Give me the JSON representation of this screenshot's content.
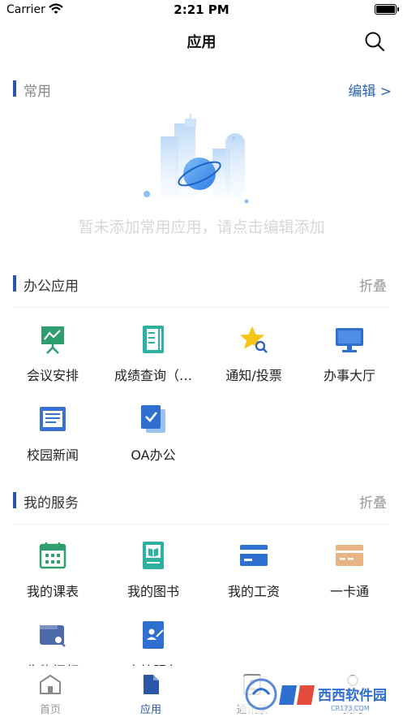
{
  "status_bar": {
    "carrier": "Carrier",
    "time": "2:21 PM"
  },
  "nav": {
    "title": "应用"
  },
  "common": {
    "title": "常用",
    "edit": "编辑 >",
    "empty_text": "暂未添加常用应用，请点击编辑添加"
  },
  "office": {
    "title": "办公应用",
    "collapse": "折叠",
    "items": [
      {
        "label": "会议安排",
        "icon": "meeting-board-icon"
      },
      {
        "label": "成绩查询（…",
        "icon": "grade-report-icon"
      },
      {
        "label": "通知/投票",
        "icon": "star-notice-icon"
      },
      {
        "label": "办事大厅",
        "icon": "monitor-icon"
      },
      {
        "label": "校园新闻",
        "icon": "newspaper-icon"
      },
      {
        "label": "OA办公",
        "icon": "check-document-icon"
      }
    ]
  },
  "services": {
    "title": "我的服务",
    "collapse": "折叠",
    "items": [
      {
        "label": "我的课表",
        "icon": "calendar-icon"
      },
      {
        "label": "我的图书",
        "icon": "book-icon"
      },
      {
        "label": "我的工资",
        "icon": "card-icon"
      },
      {
        "label": "一卡通",
        "icon": "campus-card-icon"
      },
      {
        "label": "失物招领",
        "icon": "wallet-search-icon"
      },
      {
        "label": "离校服务",
        "icon": "leave-school-icon"
      }
    ]
  },
  "tabs": [
    {
      "label": "首页",
      "icon": "home-icon",
      "active": false
    },
    {
      "label": "应用",
      "icon": "apps-icon",
      "active": true
    },
    {
      "label": "通讯录",
      "icon": "contacts-icon",
      "active": false
    },
    {
      "label": "我的",
      "icon": "profile-icon",
      "active": false
    }
  ],
  "watermark": {
    "text": "西西软件园",
    "sub": "CR173.COM"
  },
  "colors": {
    "accent": "#2a55a8",
    "edit_link": "#2a66b4",
    "muted": "#999999"
  }
}
